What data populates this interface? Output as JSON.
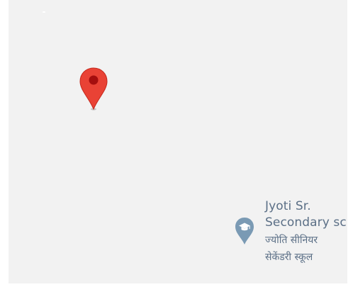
{
  "map": {
    "background": "#f2f2f2",
    "marker": {
      "icon": "location-pin-icon",
      "color": "#e94235",
      "dot_color": "#a50e0e"
    },
    "poi": {
      "icon": "school-icon",
      "icon_color": "#7a9ab4",
      "text_color": "#5b6f86",
      "name_en_line1": "Jyoti Sr.",
      "name_en_line2": "Secondary sc",
      "name_hi_line1": "ज्योति सीनियर",
      "name_hi_line2": "सेकेंडरी स्कूल"
    }
  }
}
